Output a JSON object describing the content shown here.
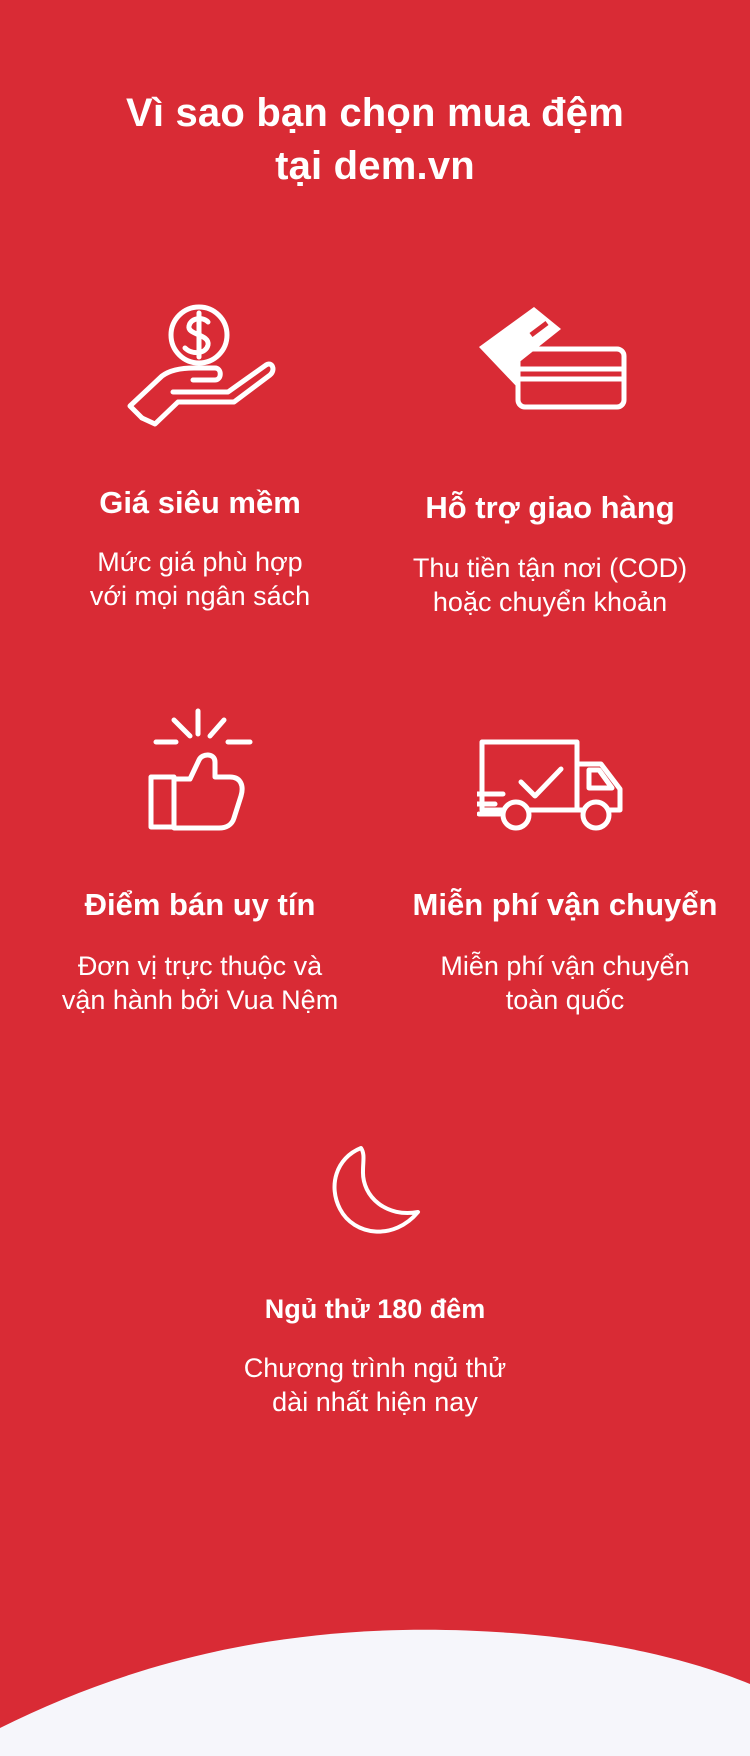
{
  "colors": {
    "background": "#d92b35",
    "text": "#ffffff",
    "wave": "#f6f6fb"
  },
  "headline": {
    "line1": "Vì sao bạn chọn mua đệm",
    "line2": "tại dem.vn"
  },
  "features": {
    "price": {
      "icon": "dollar-hand-icon",
      "title": "Giá siêu mềm",
      "text_line1": "Mức giá phù hợp",
      "text_line2": "với mọi ngân sách"
    },
    "delivery_support": {
      "icon": "credit-card-icon",
      "title": "Hỗ trợ giao hàng",
      "text_line1": "Thu tiền tận nơi (COD)",
      "text_line2": "hoặc chuyển khoản"
    },
    "trusted_store": {
      "icon": "thumbs-up-icon",
      "title": "Điểm bán uy tín",
      "text_line1": "Đơn vị trực thuộc và",
      "text_line2": "vận hành bởi Vua Nệm"
    },
    "free_shipping": {
      "icon": "delivery-truck-icon",
      "title": "Miễn phí vận chuyển",
      "text_line1": "Miễn phí vận chuyển",
      "text_line2": "toàn quốc"
    },
    "sleep_trial": {
      "icon": "moon-icon",
      "title": "Ngủ thử 180 đêm",
      "text_line1": "Chương trình ngủ thử",
      "text_line2": "dài nhất hiện nay"
    }
  }
}
